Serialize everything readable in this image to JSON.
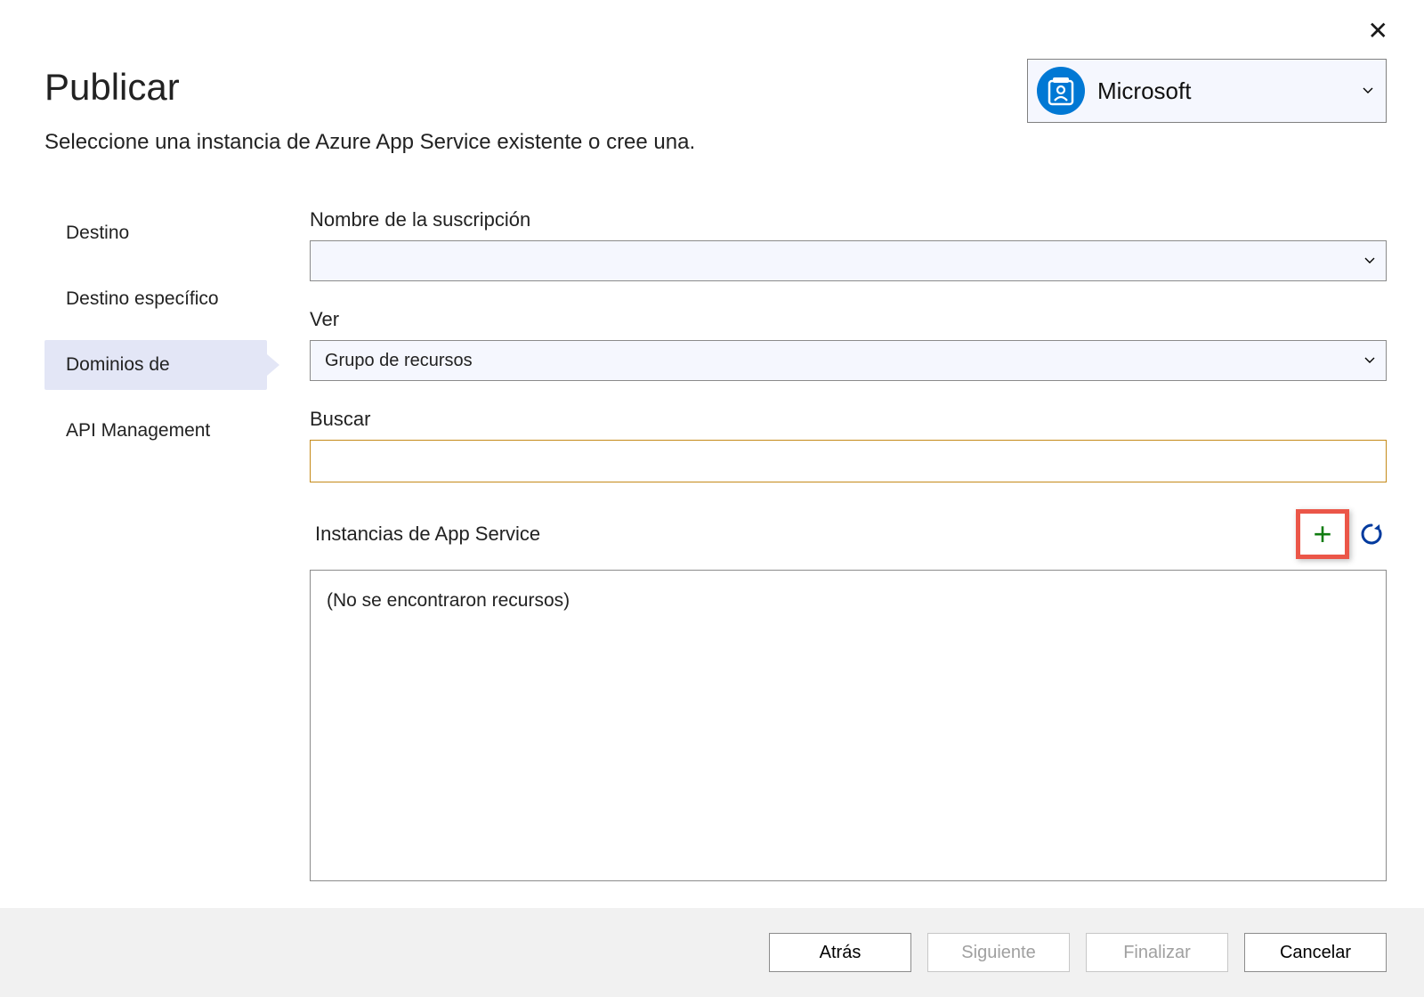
{
  "close_label": "✕",
  "header": {
    "title": "Publicar",
    "subtitle": "Seleccione una instancia de Azure App Service existente o cree una."
  },
  "account": {
    "name": "Microsoft"
  },
  "sidebar": {
    "items": [
      {
        "label": "Destino"
      },
      {
        "label": "Destino específico"
      },
      {
        "label": "Dominios de"
      },
      {
        "label": "API Management"
      }
    ]
  },
  "form": {
    "subscription_label": "Nombre de la suscripción",
    "subscription_value": "",
    "view_label": "Ver",
    "view_value": "Grupo de recursos",
    "search_label": "Buscar",
    "search_value": "",
    "instances_label": "Instancias de App Service",
    "no_resources": "(No se encontraron recursos)"
  },
  "footer": {
    "back": "Atrás",
    "next": "Siguiente",
    "finish": "Finalizar",
    "cancel": "Cancelar"
  }
}
